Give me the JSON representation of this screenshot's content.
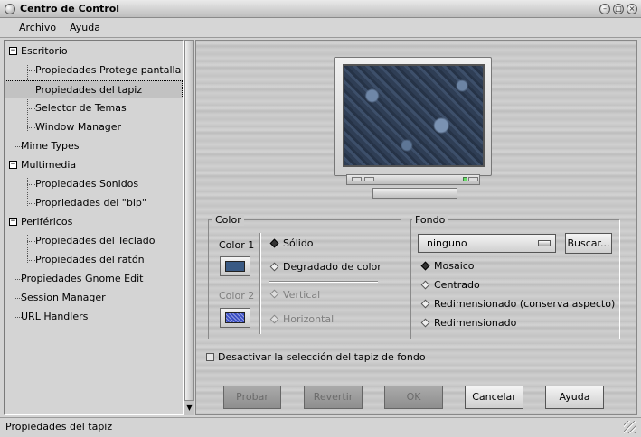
{
  "window": {
    "title": "Centro de Control"
  },
  "menubar": {
    "items": [
      "Archivo",
      "Ayuda"
    ]
  },
  "tree": {
    "items": [
      {
        "label": "Escritorio"
      },
      {
        "label": "Propiedades Protege pantalla"
      },
      {
        "label": "Propiedades del tapiz"
      },
      {
        "label": "Selector de Temas"
      },
      {
        "label": "Window Manager"
      },
      {
        "label": "Mime Types"
      },
      {
        "label": "Multimedia"
      },
      {
        "label": "Propiedades Sonidos"
      },
      {
        "label": "Propriedades del \"bip\""
      },
      {
        "label": "Periféricos"
      },
      {
        "label": "Propiedades del Teclado"
      },
      {
        "label": "Propiedades del ratón"
      },
      {
        "label": "Propiedades Gnome Edit"
      },
      {
        "label": "Session Manager"
      },
      {
        "label": "URL Handlers"
      }
    ],
    "selected": "Propiedades del tapiz"
  },
  "color_frame": {
    "title": "Color",
    "color1_label": "Color 1",
    "color2_label": "Color 2",
    "color1": "#3a5a84",
    "color2": "#3b4fc4",
    "options": {
      "solid": "Sólido",
      "gradient": "Degradado de color",
      "vertical": "Vertical",
      "horizontal": "Horizontal"
    }
  },
  "fondo_frame": {
    "title": "Fondo",
    "selected": "ninguno",
    "browse": "Buscar...",
    "options": {
      "mosaic": "Mosaico",
      "centered": "Centrado",
      "scaled_aspect": "Redimensionado (conserva aspecto)",
      "scaled": "Redimensionado"
    }
  },
  "checkbox": {
    "label": "Desactivar la selección del tapiz de fondo"
  },
  "buttons": {
    "try": "Probar",
    "revert": "Revertir",
    "ok": "OK",
    "cancel": "Cancelar",
    "help": "Ayuda"
  },
  "statusbar": {
    "text": "Propiedades del tapiz"
  }
}
